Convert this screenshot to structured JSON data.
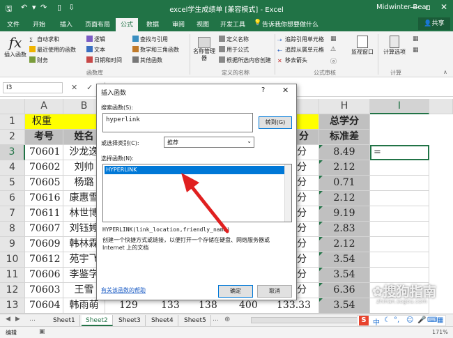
{
  "window": {
    "title": "excel学生成绩单 [兼容模式] - Excel",
    "user": "Midwinter Bear",
    "share": "共享"
  },
  "tabs": [
    "文件",
    "开始",
    "插入",
    "页面布局",
    "公式",
    "数据",
    "审阅",
    "视图",
    "开发工具"
  ],
  "tell_me": "告诉我你想要做什么",
  "ribbon": {
    "insert_function": "插入函数",
    "library": [
      [
        "自动求和",
        "最近使用的函数",
        "财务"
      ],
      [
        "逻辑",
        "文本",
        "日期和时间"
      ],
      [
        "查找与引用",
        "数学和三角函数",
        "其他函数"
      ]
    ],
    "group_library": "函数库",
    "name_manager": "名称管理器",
    "defined": [
      "定义名称",
      "用于公式",
      "根据所选内容创建"
    ],
    "group_defined": "定义的名称",
    "audit": [
      [
        "追踪引用单元格",
        "追踪从属单元格",
        "移去箭头"
      ]
    ],
    "group_audit": "公式审核",
    "watch": "监视窗口",
    "calc_options": "计算选项",
    "group_calc": "计算"
  },
  "formula_bar": {
    "name_box": "I3",
    "content": ""
  },
  "grid": {
    "col_headers": [
      "A",
      "B",
      "H",
      "I"
    ],
    "row_numbers": [
      "1",
      "2",
      "3",
      "4",
      "5",
      "6",
      "7",
      "8",
      "9",
      "10",
      "11",
      "12",
      "13"
    ],
    "row1": {
      "a": "权重",
      "h": "总学分"
    },
    "row2": {
      "a": "考号",
      "b": "姓名",
      "g": "分",
      "h": "标准差"
    },
    "active_cell": "=",
    "rows": [
      {
        "a": "70601",
        "b": "沙龙逸",
        "h": "8.49"
      },
      {
        "a": "70602",
        "b": "刘帅",
        "h": "2.12"
      },
      {
        "a": "70605",
        "b": "杨璐",
        "h": "0.71"
      },
      {
        "a": "70616",
        "b": "康惠雪",
        "h": "2.12"
      },
      {
        "a": "70611",
        "b": "林世博",
        "h": "9.19"
      },
      {
        "a": "70607",
        "b": "刘钰婷",
        "h": "2.83"
      },
      {
        "a": "70609",
        "b": "韩林霖",
        "h": "2.12"
      },
      {
        "a": "70612",
        "b": "苑宇飞",
        "h": "3.54"
      },
      {
        "a": "70606",
        "b": "李鉴学",
        "h": "3.54"
      },
      {
        "a": "70603",
        "b": "王雪",
        "h": "6.36"
      },
      {
        "a": "70604",
        "b": "韩雨萌",
        "c": "129",
        "d": "133",
        "e": "138",
        "f": "400",
        "g": "133.33",
        "h": "3.54"
      }
    ],
    "col_g_visible": [
      "分",
      "分",
      "分",
      "分",
      "分",
      "分",
      "分",
      "分",
      "分",
      "分",
      "分"
    ]
  },
  "dialog": {
    "title": "插入函数",
    "help": "?",
    "close": "✕",
    "search_label": "搜索函数(S):",
    "search_value": "hyperlink",
    "go_button": "转到(G)",
    "category_label": "或选择类别(C):",
    "category_value": "推荐",
    "select_label": "选择函数(N):",
    "functions": [
      "HYPERLINK"
    ],
    "signature": "HYPERLINK(link_location,friendly_name)",
    "description": "创建一个快捷方式或链接，以便打开一个存储在硬盘、网络服务器或 Internet 上的文档",
    "help_link": "有关该函数的帮助",
    "ok": "确定",
    "cancel": "取消"
  },
  "sheets": [
    "Sheet1",
    "Sheet2",
    "Sheet3",
    "Sheet4",
    "Sheet5"
  ],
  "active_sheet": "Sheet2",
  "status": {
    "mode": "编辑",
    "zoom": "171%"
  },
  "watermark": "搜狗指南",
  "watermark_url": "zhinan.sogou.com",
  "ime": "中",
  "colors": {
    "excel_green": "#217346",
    "highlight": "#ffff00",
    "gray_col": "#c0c0c0",
    "arrow": "#e02020",
    "select_blue": "#0078d7"
  }
}
